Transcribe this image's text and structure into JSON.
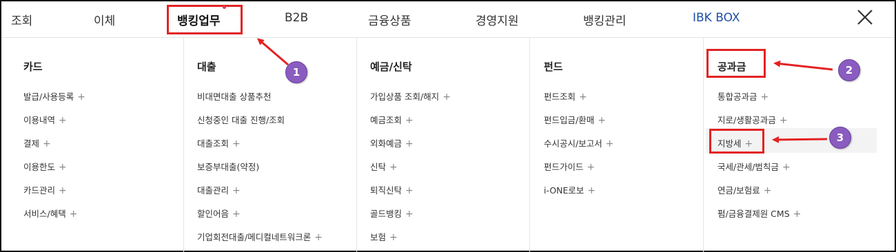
{
  "nav": {
    "items": [
      "조회",
      "이체",
      "뱅킹업무",
      "B2B",
      "금융상품",
      "경영지원",
      "뱅킹관리",
      "IBK BOX"
    ],
    "active_index": 2
  },
  "columns": [
    {
      "title": "카드",
      "items": [
        {
          "label": "발급/사용등록",
          "plus": "+"
        },
        {
          "label": "이용내역",
          "plus": "+"
        },
        {
          "label": "결제",
          "plus": "+"
        },
        {
          "label": "이용한도",
          "plus": "+"
        },
        {
          "label": "카드관리",
          "plus": "+"
        },
        {
          "label": "서비스/혜택",
          "plus": "+"
        }
      ]
    },
    {
      "title": "대출",
      "items": [
        {
          "label": "비대면대출 상품추천",
          "plus": ""
        },
        {
          "label": "신청중인 대출 진행/조회",
          "plus": ""
        },
        {
          "label": "대출조회",
          "plus": "+"
        },
        {
          "label": "보증부대출(약정)",
          "plus": ""
        },
        {
          "label": "대출관리",
          "plus": "+"
        },
        {
          "label": "할인어음",
          "plus": "+"
        },
        {
          "label": "기업회전대출/메디컬네트워크론",
          "plus": "+"
        }
      ]
    },
    {
      "title": "예금/신탁",
      "items": [
        {
          "label": "가입상품 조회/해지",
          "plus": "+"
        },
        {
          "label": "예금조회",
          "plus": "+"
        },
        {
          "label": "외화예금",
          "plus": "+"
        },
        {
          "label": "신탁",
          "plus": "+"
        },
        {
          "label": "퇴직신탁",
          "plus": "+"
        },
        {
          "label": "골드뱅킹",
          "plus": "+"
        },
        {
          "label": "보험",
          "plus": "+"
        }
      ]
    },
    {
      "title": "펀드",
      "items": [
        {
          "label": "펀드조회",
          "plus": "+"
        },
        {
          "label": "펀드입금/환매",
          "plus": "+"
        },
        {
          "label": "수시공시/보고서",
          "plus": "+"
        },
        {
          "label": "펀드가이드",
          "plus": "+"
        },
        {
          "label": "i-ONE로보",
          "plus": "+"
        }
      ]
    },
    {
      "title": "공과금",
      "items": [
        {
          "label": "통합공과금",
          "plus": "+"
        },
        {
          "label": "지로/생활공과금",
          "plus": "+"
        },
        {
          "label": "지방세",
          "plus": "+"
        },
        {
          "label": "국세/관세/범칙금",
          "plus": "+"
        },
        {
          "label": "연금/보험료",
          "plus": "+"
        },
        {
          "label": "펌/금융결제원 CMS",
          "plus": "+"
        }
      ]
    }
  ],
  "annotations": {
    "badges": [
      "1",
      "2",
      "3"
    ],
    "color": "#e32222",
    "badge_color": "#8a5cc0"
  }
}
